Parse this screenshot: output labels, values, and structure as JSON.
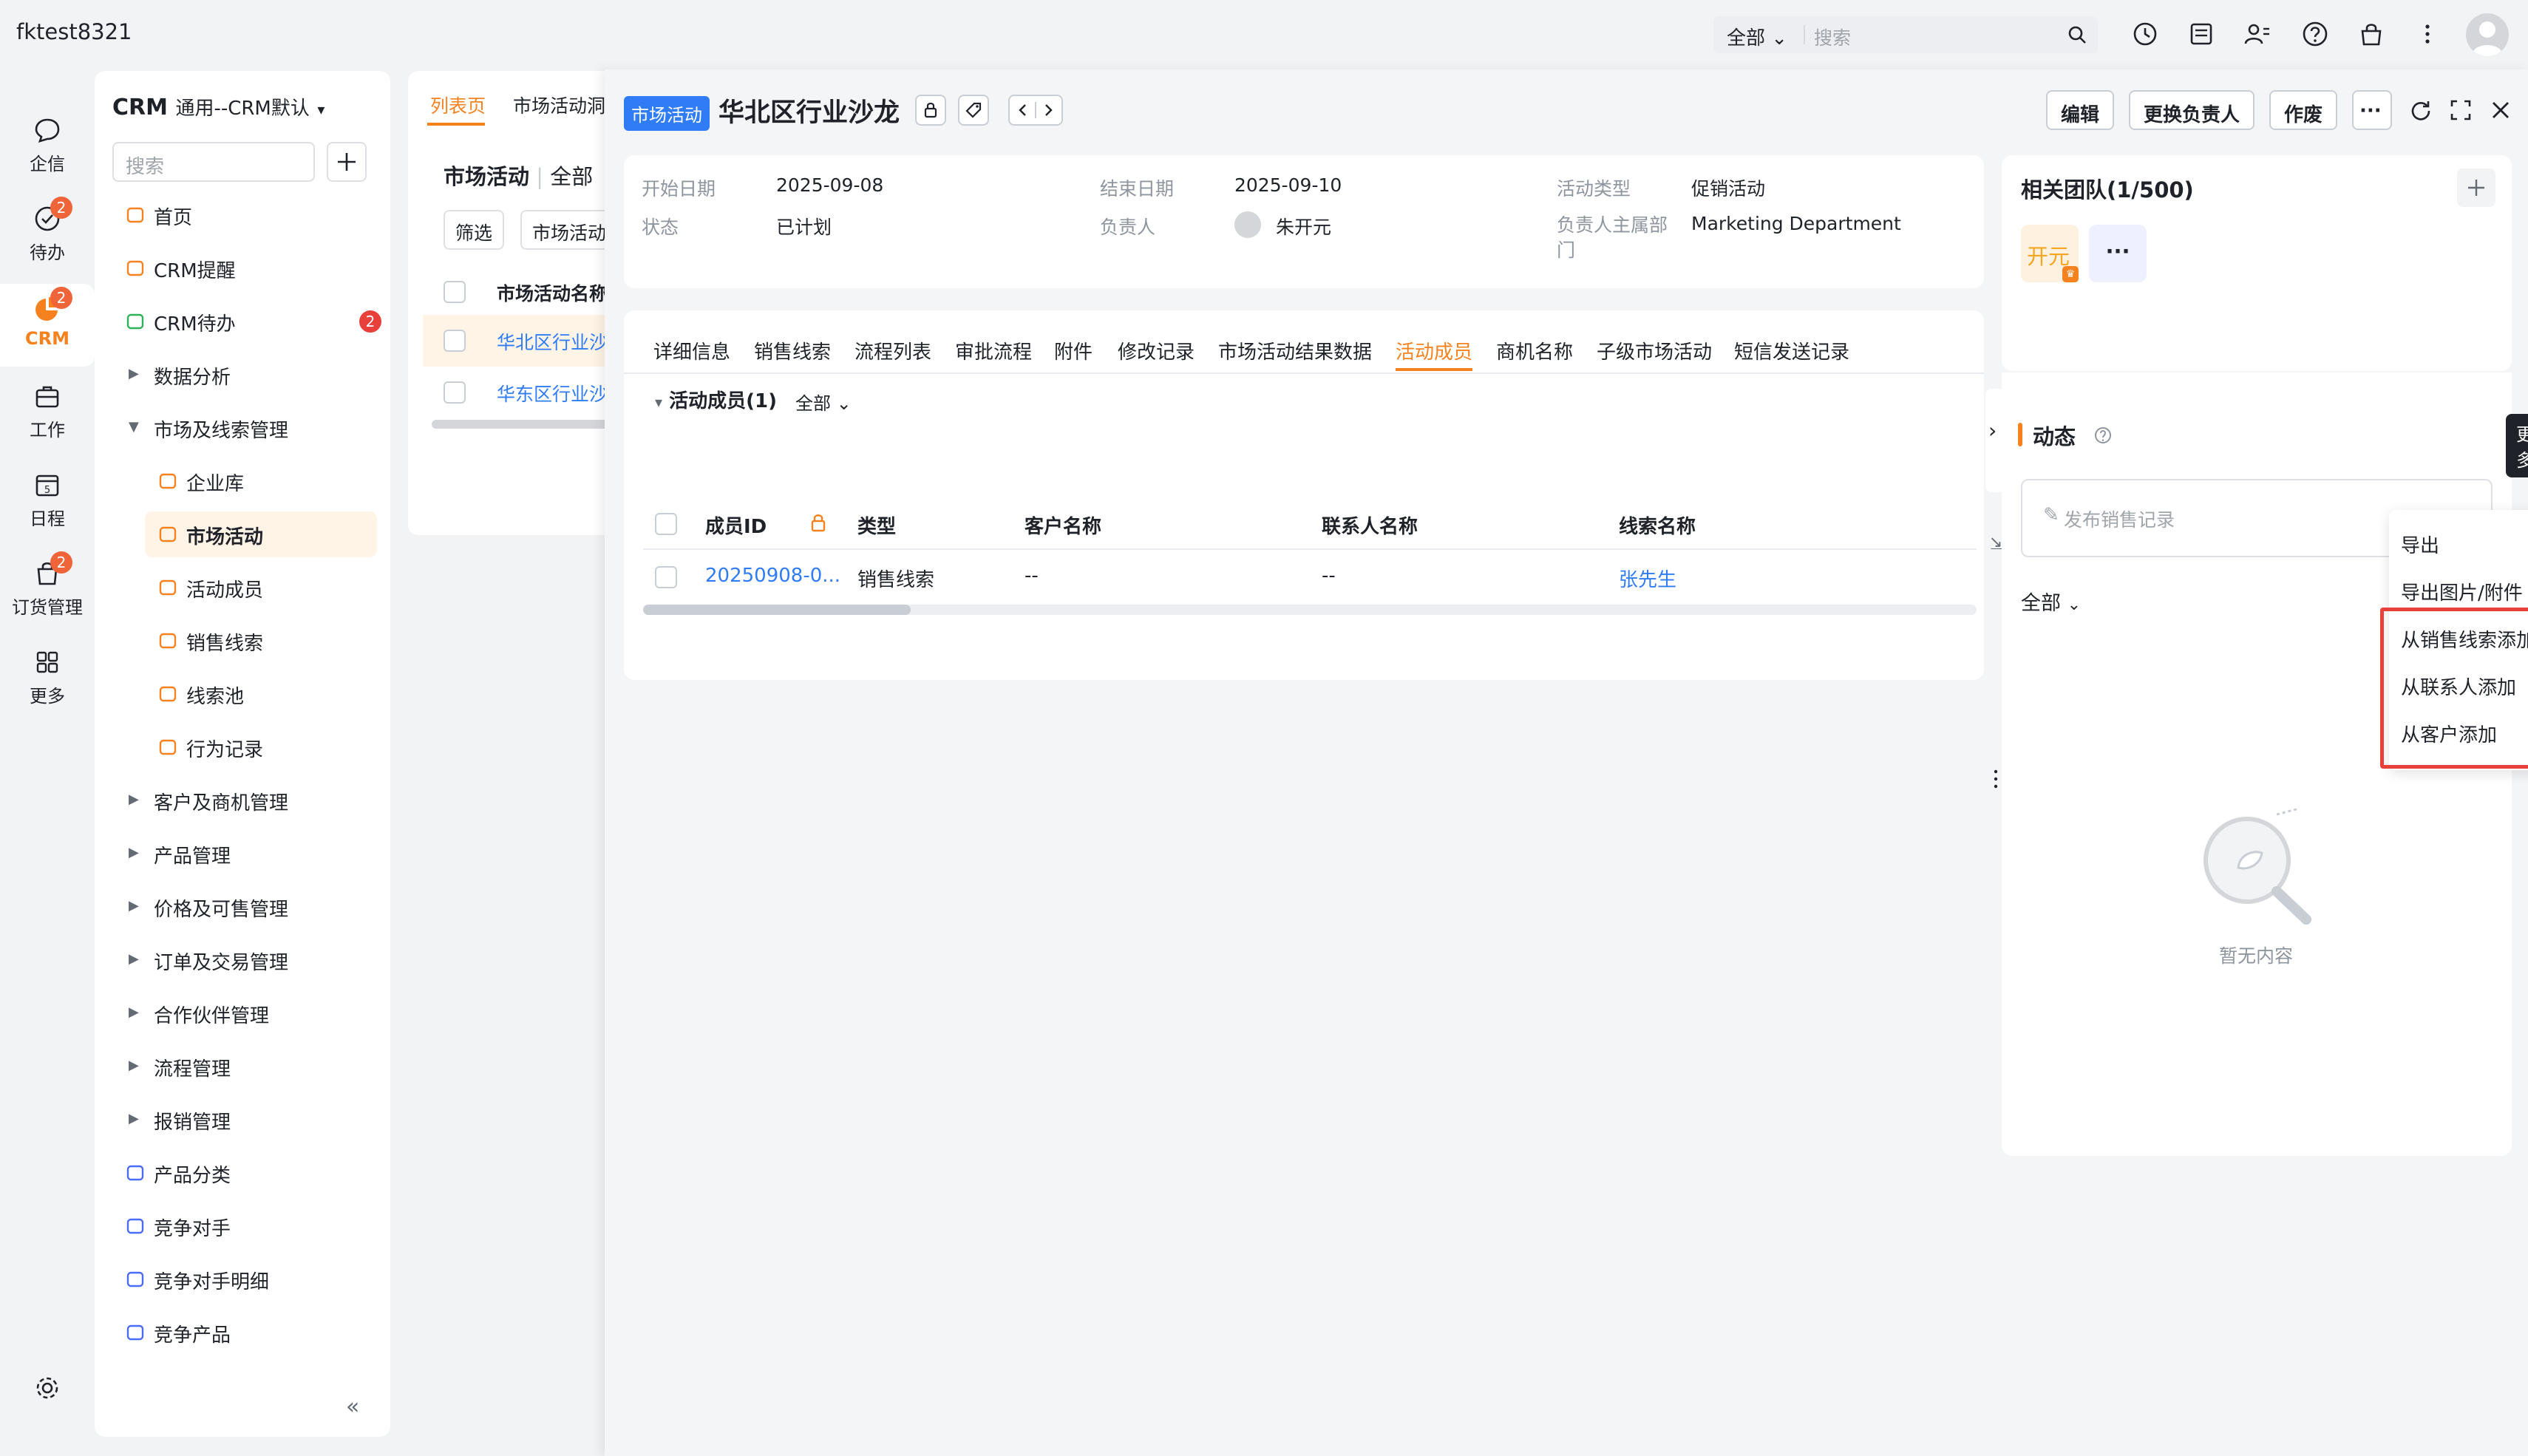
{
  "topbar": {
    "username": "fktest8321",
    "search_scope": "全部",
    "search_placeholder": "搜索"
  },
  "rail": {
    "items": [
      {
        "label": "企信",
        "badge": ""
      },
      {
        "label": "待办",
        "badge": "2"
      },
      {
        "label": "CRM",
        "badge": "2"
      },
      {
        "label": "工作",
        "badge": ""
      },
      {
        "label": "日程",
        "badge": ""
      },
      {
        "label": "订货管理",
        "badge": "2"
      },
      {
        "label": "更多",
        "badge": ""
      }
    ],
    "active_color": "#f5821f"
  },
  "nav": {
    "title": "CRM",
    "subtitle": "通用--CRM默认",
    "search_placeholder": "搜索",
    "items": [
      {
        "label": "首页"
      },
      {
        "label": "CRM提醒"
      },
      {
        "label": "CRM待办",
        "badge": "2"
      },
      {
        "label": "数据分析"
      },
      {
        "label": "市场及线索管理"
      },
      {
        "label": "企业库"
      },
      {
        "label": "市场活动"
      },
      {
        "label": "活动成员"
      },
      {
        "label": "销售线索"
      },
      {
        "label": "线索池"
      },
      {
        "label": "行为记录"
      },
      {
        "label": "客户及商机管理"
      },
      {
        "label": "产品管理"
      },
      {
        "label": "价格及可售管理"
      },
      {
        "label": "订单及交易管理"
      },
      {
        "label": "合作伙伴管理"
      },
      {
        "label": "流程管理"
      },
      {
        "label": "报销管理"
      },
      {
        "label": "产品分类"
      },
      {
        "label": "竞争对手"
      },
      {
        "label": "竞争对手明细"
      },
      {
        "label": "竞争产品"
      }
    ]
  },
  "listpage": {
    "tabs": [
      "列表页",
      "市场活动洞"
    ],
    "heading": "市场活动",
    "scope": "全部",
    "filter_btn": "筛选",
    "type_btn": "市场活动",
    "col_name": "市场活动名称",
    "rows": [
      "华北区行业沙",
      "华东区行业沙"
    ]
  },
  "detail": {
    "tag": "市场活动",
    "title": "华北区行业沙龙",
    "actions": {
      "edit": "编辑",
      "change_owner": "更换负责人",
      "void": "作废",
      "more": "···"
    },
    "info": {
      "start_label": "开始日期",
      "start": "2025-09-08",
      "end_label": "结束日期",
      "end": "2025-09-10",
      "type_label": "活动类型",
      "type": "促销活动",
      "status_label": "状态",
      "status": "已计划",
      "owner_label": "负责人",
      "owner": "朱开元",
      "dept_label": "负责人主属部门",
      "dept": "Marketing Department"
    },
    "tabs": [
      "详细信息",
      "销售线索",
      "流程列表",
      "审批流程",
      "附件",
      "修改记录",
      "市场活动结果数据",
      "活动成员",
      "商机名称",
      "子级市场活动",
      "短信发送记录"
    ],
    "members": {
      "section_title": "活动成员(1)",
      "scope": "全部",
      "columns": [
        "成员ID",
        "类型",
        "客户名称",
        "联系人名称",
        "线索名称"
      ],
      "rows": [
        {
          "id": "20250908-0...",
          "type": "销售线索",
          "customer": "--",
          "contact": "--",
          "lead": "张先生"
        }
      ]
    },
    "tooltip": "更多",
    "menu": [
      "导出",
      "导出图片/附件",
      "从销售线索添加",
      "从联系人添加",
      "从客户添加"
    ]
  },
  "team": {
    "title": "相关团队(1/500)",
    "member_chip": "开元",
    "more_chip": "···"
  },
  "dynamics": {
    "title": "动态",
    "post_placeholder": "发布销售记录",
    "filter": "全部",
    "empty": "暂无内容"
  }
}
